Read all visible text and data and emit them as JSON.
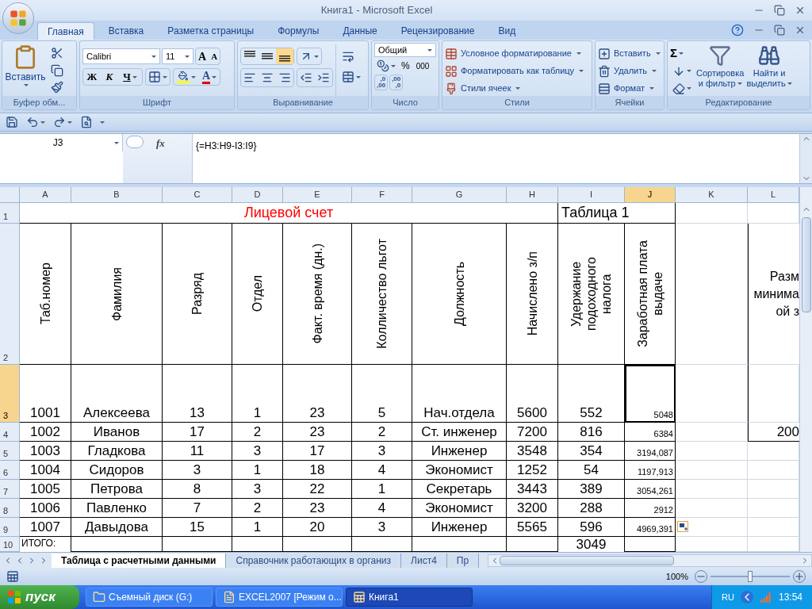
{
  "window": {
    "title": "Книга1 - Microsoft Excel"
  },
  "ribbon_tabs": [
    {
      "label": "Главная",
      "selected": true
    },
    {
      "label": "Вставка",
      "selected": false
    },
    {
      "label": "Разметка страницы",
      "selected": false
    },
    {
      "label": "Формулы",
      "selected": false
    },
    {
      "label": "Данные",
      "selected": false
    },
    {
      "label": "Рецензирование",
      "selected": false
    },
    {
      "label": "Вид",
      "selected": false
    }
  ],
  "clipboard": {
    "label": "Буфер обм...",
    "paste": "Вставить"
  },
  "font": {
    "label": "Шрифт",
    "name": "Calibri",
    "size": "11",
    "grow": "A",
    "shrink": "A",
    "bold": "Ж",
    "italic": "К",
    "underline": "Ч",
    "font_color": "A"
  },
  "alignment": {
    "label": "Выравнивание"
  },
  "number": {
    "label": "Число",
    "format": "Общий",
    "percent": "%",
    "thousands": "000",
    "increase_decimal": [
      ",0",
      ",00"
    ],
    "decrease_decimal": [
      ",00",
      ",0"
    ]
  },
  "styles": {
    "label": "Стили",
    "items": [
      "Условное форматирование",
      "Форматировать как таблицу",
      "Стили ячеек"
    ]
  },
  "cells": {
    "label": "Ячейки",
    "items": [
      "Вставить",
      "Удалить",
      "Формат"
    ]
  },
  "editing": {
    "label": "Редактирование",
    "autosum": "Σ",
    "sort": [
      "Сортировка",
      "и фильтр"
    ],
    "find": [
      "Найти и",
      "выделить"
    ]
  },
  "formula_bar": {
    "name_box": "J3",
    "fx": "fx",
    "formula": "{=H3:H9-I3:I9}"
  },
  "sheet": {
    "columns": [
      {
        "label": "A",
        "selected": false
      },
      {
        "label": "B",
        "selected": false
      },
      {
        "label": "C",
        "selected": false
      },
      {
        "label": "D",
        "selected": false
      },
      {
        "label": "E",
        "selected": false
      },
      {
        "label": "F",
        "selected": false
      },
      {
        "label": "G",
        "selected": false
      },
      {
        "label": "H",
        "selected": false
      },
      {
        "label": "I",
        "selected": false
      },
      {
        "label": "J",
        "selected": true
      },
      {
        "label": "K",
        "selected": false
      },
      {
        "label": "L",
        "selected": false
      }
    ],
    "title_row": {
      "number": "1",
      "selected": false,
      "title": "Лицевой счет",
      "label": "Таблица 1"
    },
    "header_row": {
      "number": "2",
      "selected": false,
      "headers": [
        {
          "lines": [
            "Таб.номер"
          ]
        },
        {
          "lines": [
            "Фамилия"
          ]
        },
        {
          "lines": [
            "Разряд"
          ]
        },
        {
          "lines": [
            "Отдел"
          ]
        },
        {
          "lines": [
            "Факт. время (дн.)"
          ]
        },
        {
          "lines": [
            "Колличество льгот"
          ]
        },
        {
          "lines": [
            "Должность"
          ]
        },
        {
          "lines": [
            "Начислено з/п"
          ]
        },
        {
          "lines": [
            "Удержание",
            "подоходного",
            "налога"
          ]
        },
        {
          "lines": [
            "Заработная плата",
            "выдаче"
          ]
        }
      ],
      "column_l": [
        "Разм",
        "минима",
        "ой з"
      ]
    },
    "data_rows": [
      {
        "number": "3",
        "selected": true,
        "last_cell_selected": true,
        "cells": [
          "1001",
          "Алексеева",
          "13",
          "1",
          "23",
          "5",
          "Нач.отдела",
          "5600",
          "552",
          "5048"
        ]
      },
      {
        "number": "4",
        "selected": false,
        "last_cell_selected": false,
        "cells": [
          "1002",
          "Иванов",
          "17",
          "2",
          "23",
          "2",
          "Ст. инженер",
          "7200",
          "816",
          "6384"
        ],
        "column_l": "200"
      },
      {
        "number": "5",
        "selected": false,
        "last_cell_selected": false,
        "cells": [
          "1003",
          "Гладкова",
          "11",
          "3",
          "17",
          "3",
          "Инженер",
          "3548",
          "354",
          "3194,087"
        ]
      },
      {
        "number": "6",
        "selected": false,
        "last_cell_selected": false,
        "cells": [
          "1004",
          "Сидоров",
          "3",
          "1",
          "18",
          "4",
          "Экономист",
          "1252",
          "54",
          "1197,913"
        ]
      },
      {
        "number": "7",
        "selected": false,
        "last_cell_selected": false,
        "cells": [
          "1005",
          "Петрова",
          "8",
          "3",
          "22",
          "1",
          "Секретарь",
          "3443",
          "389",
          "3054,261"
        ]
      },
      {
        "number": "8",
        "selected": false,
        "last_cell_selected": false,
        "cells": [
          "1006",
          "Павленко",
          "7",
          "2",
          "23",
          "4",
          "Экономист",
          "3200",
          "288",
          "2912"
        ]
      },
      {
        "number": "9",
        "selected": false,
        "last_cell_selected": false,
        "cells": [
          "1007",
          "Давыдова",
          "15",
          "1",
          "20",
          "3",
          "Инженер",
          "5565",
          "596",
          "4969,391"
        ]
      }
    ],
    "total_row": {
      "number": "10",
      "selected": false,
      "label": "ИТОГО:",
      "value": "3049"
    }
  },
  "sheet_tabs": [
    {
      "label": "Таблица с расчетными данными",
      "selected": true
    },
    {
      "label": "Справочник работающих в организ",
      "selected": false
    },
    {
      "label": "Лист4",
      "selected": false
    },
    {
      "label": "Пр",
      "selected": false
    }
  ],
  "status_bar": {
    "zoom": "100%",
    "level": 0.5
  },
  "taskbar": {
    "start": "пуск",
    "tasks": [
      {
        "label": "Съемный диск (G:)",
        "kind": "folder",
        "selected": false
      },
      {
        "label": "EXCEL2007 [Режим о...",
        "kind": "document",
        "selected": false
      },
      {
        "label": "Книга1",
        "kind": "spreadsheet",
        "selected": true
      }
    ],
    "language": "RU",
    "clock": "13:54"
  }
}
